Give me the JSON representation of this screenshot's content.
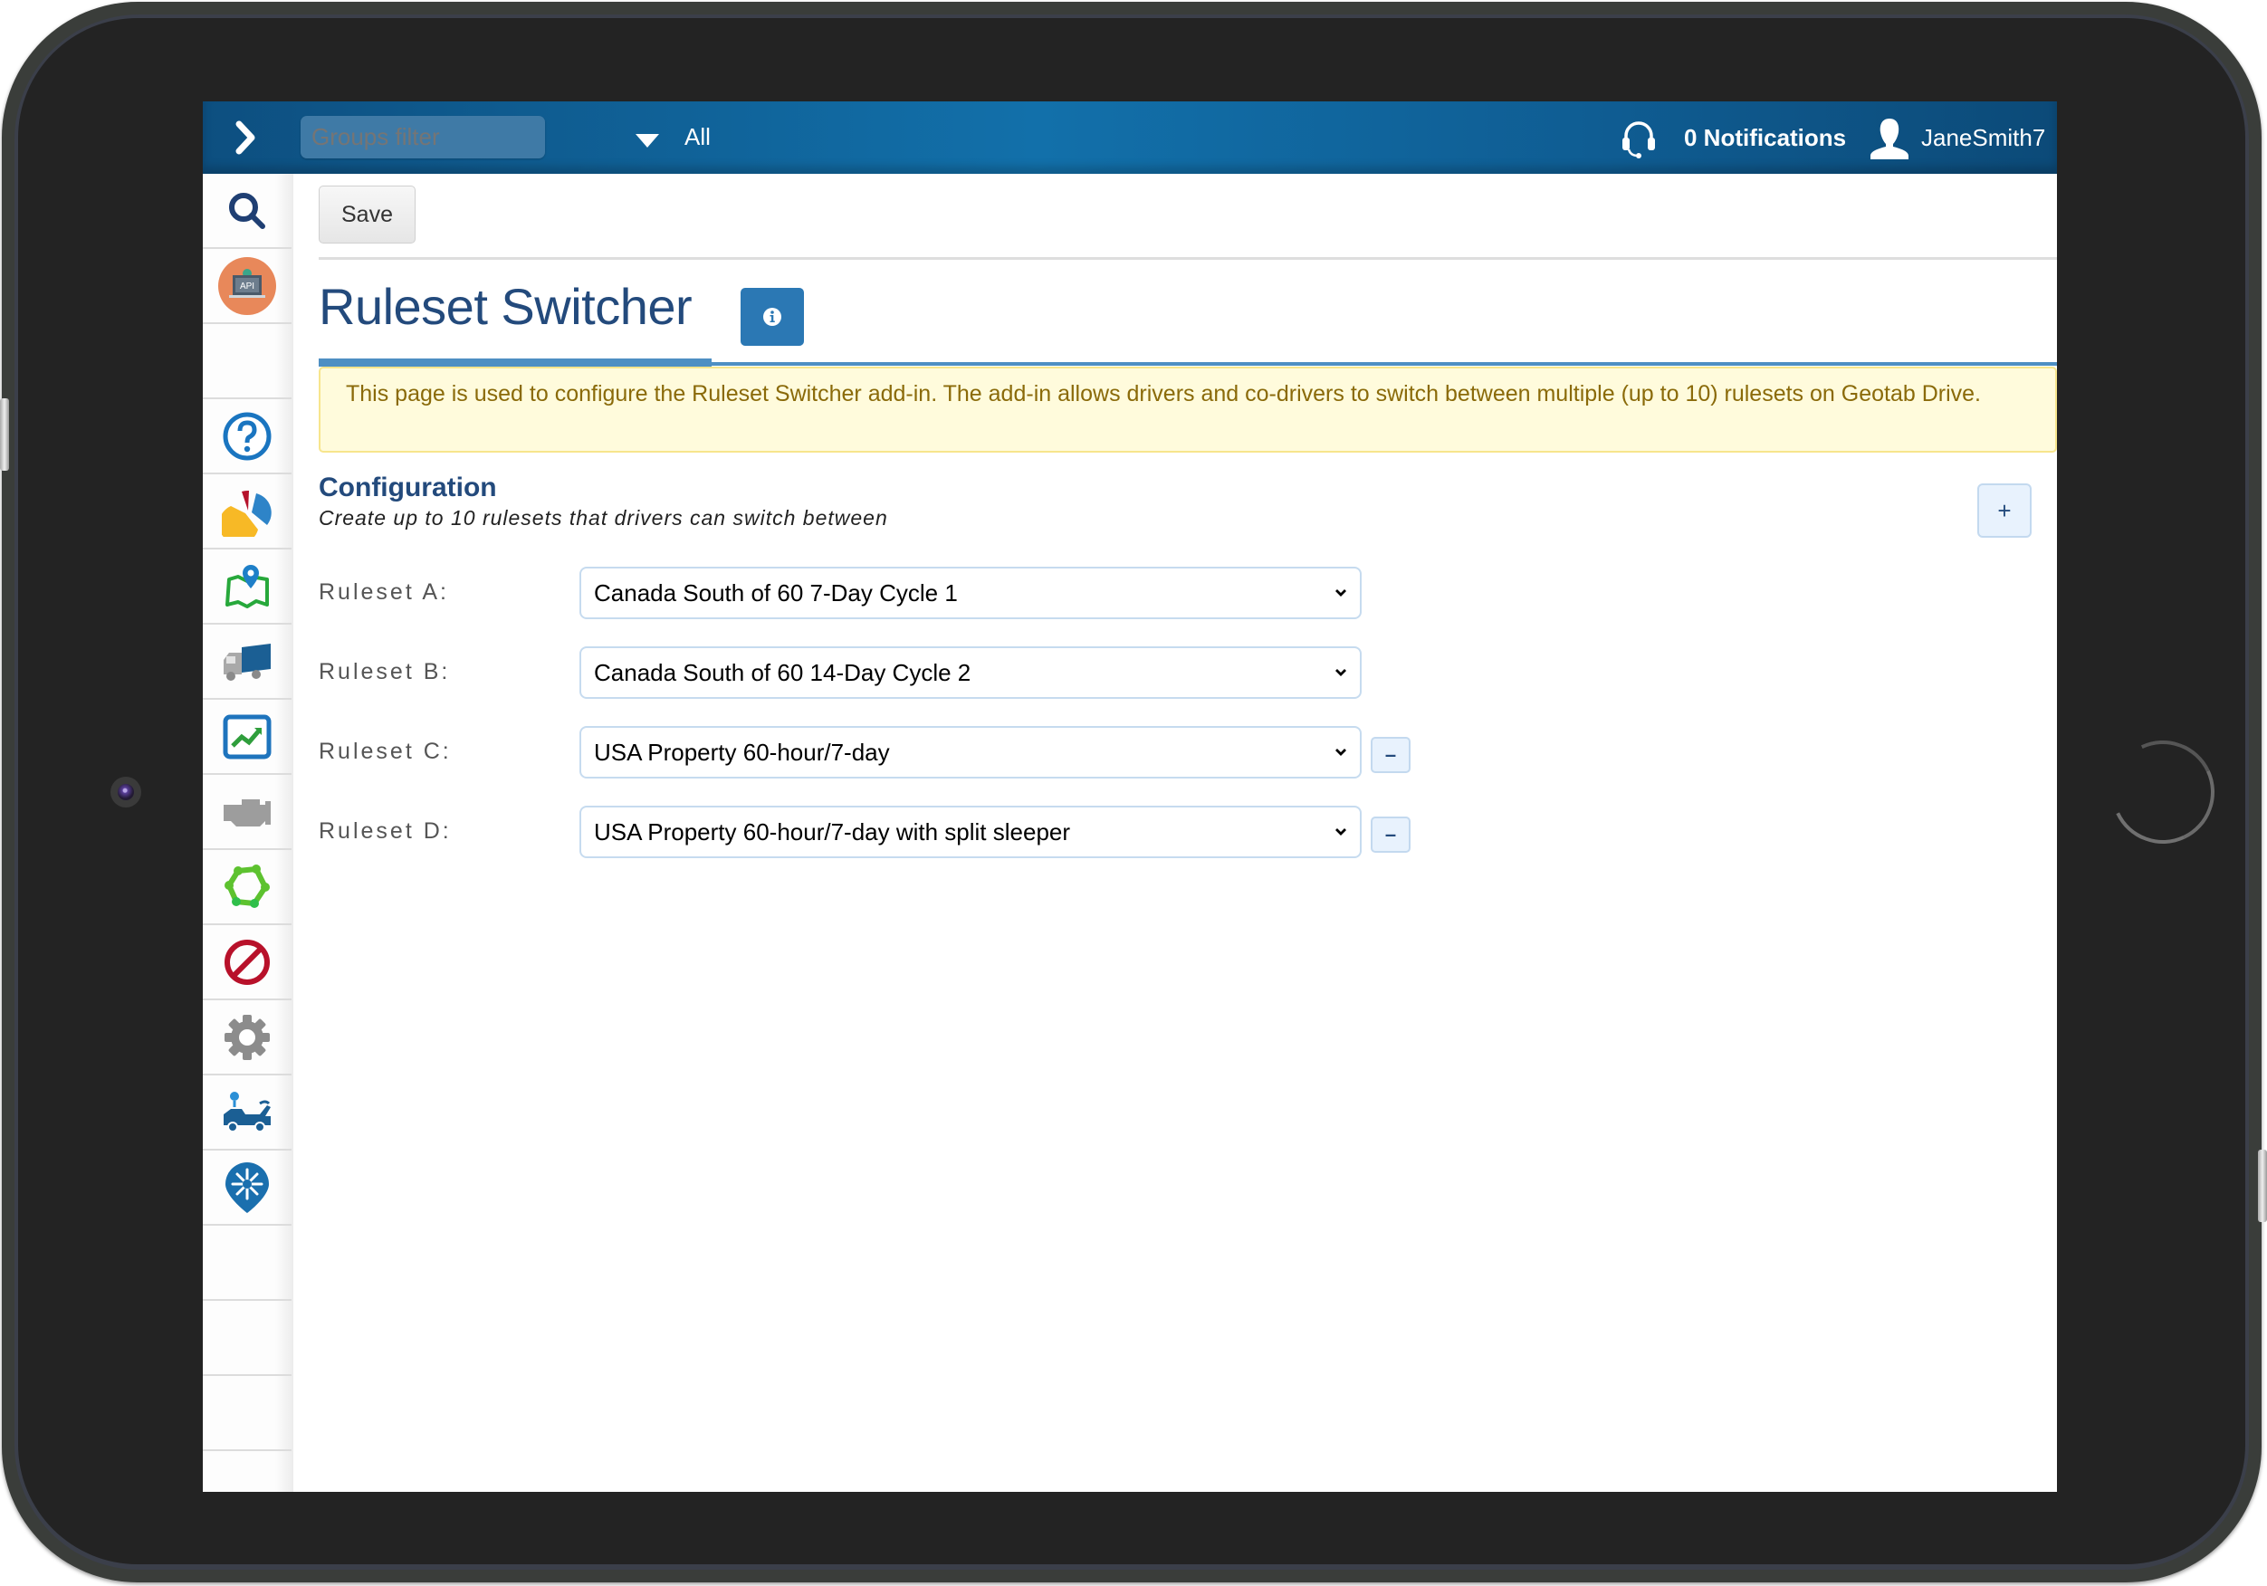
{
  "topbar": {
    "groups_filter_placeholder": "Groups filter",
    "groups_selected": "All",
    "notifications_label": "0 Notifications",
    "username": "JaneSmith7",
    "colors": {
      "bar": "#1270aa",
      "filter_bg": "#3f7aa6"
    }
  },
  "sidebar": {
    "items": [
      {
        "icon": "search-icon"
      },
      {
        "icon": "api-addin-icon"
      },
      {
        "icon": "blank"
      },
      {
        "icon": "help-icon"
      },
      {
        "icon": "pie-chart-icon"
      },
      {
        "icon": "map-icon"
      },
      {
        "icon": "truck-icon"
      },
      {
        "icon": "activity-chart-icon"
      },
      {
        "icon": "engine-icon"
      },
      {
        "icon": "rules-icon"
      },
      {
        "icon": "exceptions-icon"
      },
      {
        "icon": "gear-icon"
      },
      {
        "icon": "tow-truck-icon"
      },
      {
        "icon": "move-pin-icon"
      },
      {
        "icon": "blank"
      },
      {
        "icon": "blank"
      },
      {
        "icon": "blank"
      }
    ]
  },
  "toolbar": {
    "save_label": "Save"
  },
  "page": {
    "title": "Ruleset Switcher",
    "info_icon": "info-icon",
    "notice": "This page is used to configure the Ruleset Switcher add-in. The add-in allows drivers and co-drivers to switch between multiple (up to 10) rulesets on Geotab Drive.",
    "accent": "#234a7c"
  },
  "configuration": {
    "title": "Configuration",
    "subtitle": "Create up to 10 rulesets that drivers can switch between",
    "add_label": "+",
    "remove_label": "–",
    "rulesets": [
      {
        "label": "Ruleset A:",
        "value": "Canada South of 60 7-Day Cycle 1",
        "removable": false
      },
      {
        "label": "Ruleset B:",
        "value": "Canada South of 60 14-Day Cycle 2",
        "removable": false
      },
      {
        "label": "Ruleset C:",
        "value": "USA Property 60-hour/7-day",
        "removable": true
      },
      {
        "label": "Ruleset D:",
        "value": "USA Property 60-hour/7-day with split sleeper",
        "removable": true
      }
    ]
  }
}
